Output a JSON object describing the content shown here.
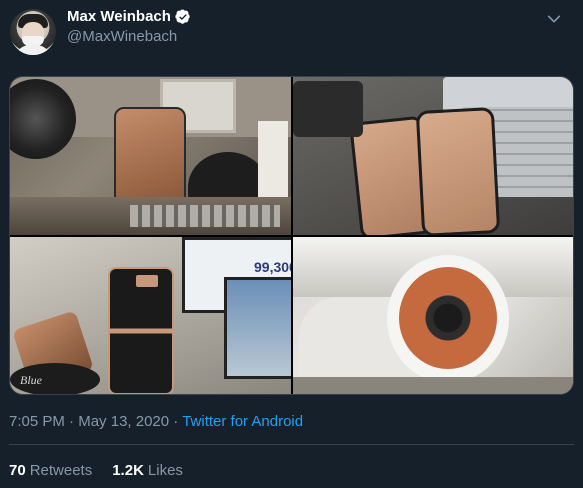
{
  "tweet": {
    "author": {
      "display_name": "Max Weinbach",
      "handle": "@MaxWinebach",
      "verified": true,
      "avatar_icon": "avatar"
    },
    "media": {
      "count": 4,
      "visible_text": {
        "monitor_number": "99,300",
        "speaker_logo": "Blue"
      }
    },
    "time": "7:05 PM",
    "date": "May 13, 2020",
    "separator": "·",
    "source": "Twitter for Android",
    "retweets_count": "70",
    "retweets_label": "Retweets",
    "likes_count": "1.2K",
    "likes_label": "Likes"
  },
  "colors": {
    "background": "#15202b",
    "text_primary": "#ffffff",
    "text_secondary": "#8899a6",
    "link": "#1da1f2",
    "border": "#38444d"
  },
  "icons": {
    "verified": "verified-badge-icon",
    "more": "chevron-down-icon"
  }
}
